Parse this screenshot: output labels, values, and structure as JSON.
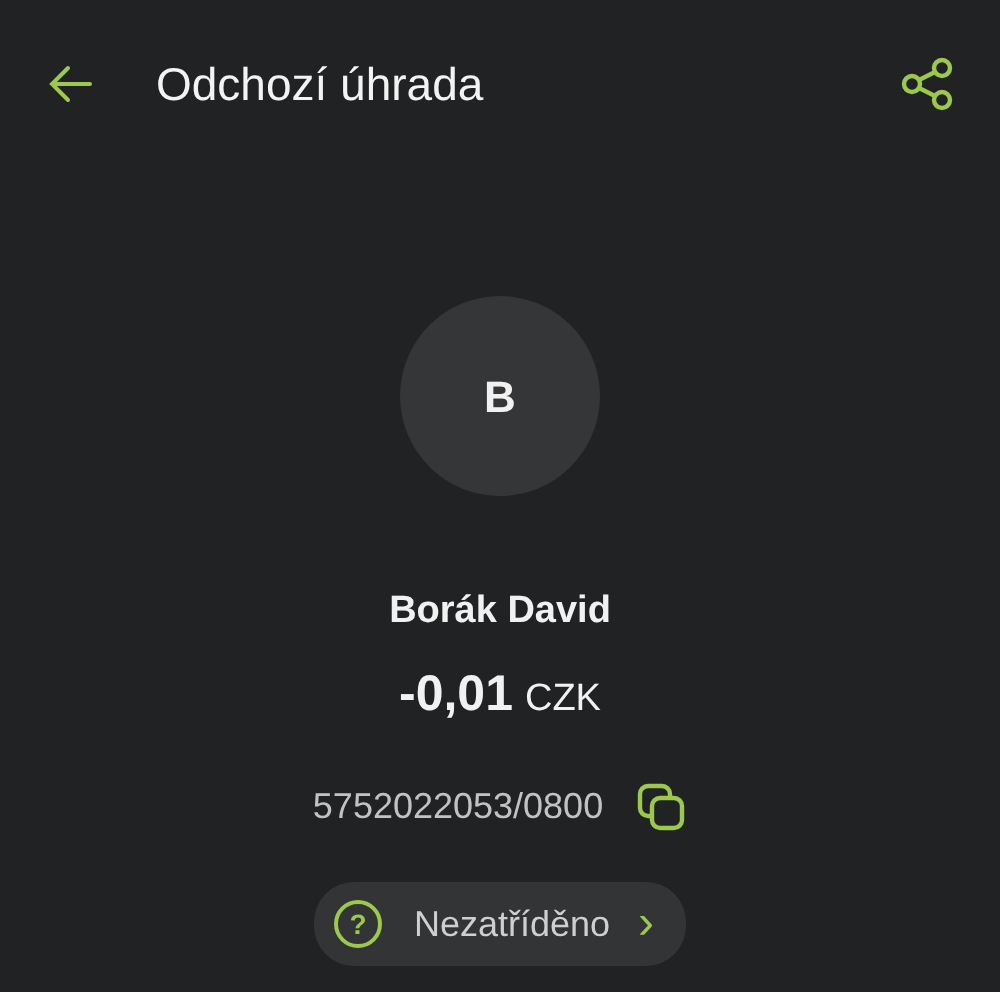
{
  "header": {
    "title": "Odchozí úhrada"
  },
  "avatar": {
    "initial": "B"
  },
  "counterparty": {
    "name": "Borák David"
  },
  "amount": {
    "value": "-0,01",
    "currency": "CZK"
  },
  "account": {
    "number": "5752022053/0800"
  },
  "category": {
    "label": "Nezatříděno",
    "icon": "?",
    "chevron": "›"
  }
}
